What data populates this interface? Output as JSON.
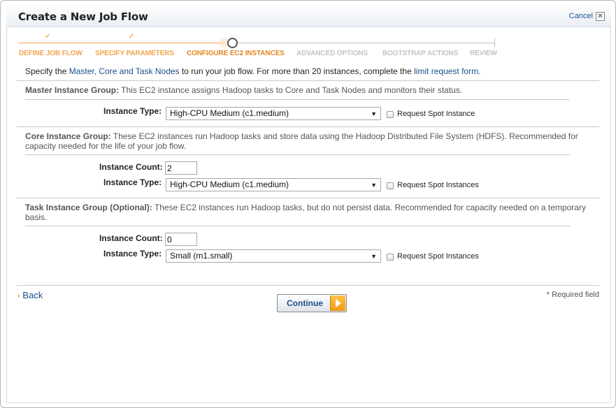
{
  "dialog": {
    "title": "Create a New Job Flow",
    "cancel_label": "Cancel",
    "close_glyph": "✕"
  },
  "wizard": {
    "steps": [
      {
        "label": "DEFINE JOB FLOW",
        "state": "done"
      },
      {
        "label": "SPECIFY PARAMETERS",
        "state": "done"
      },
      {
        "label": "CONFIGURE EC2 INSTANCES",
        "state": "current"
      },
      {
        "label": "ADVANCED OPTIONS",
        "state": "todo"
      },
      {
        "label": "BOOTSTRAP ACTIONS",
        "state": "todo"
      },
      {
        "label": "REVIEW",
        "state": "todo"
      }
    ],
    "check_glyph": "✓"
  },
  "intro": {
    "prefix": "Specify the ",
    "link1": "Master, Core and Task Nodes",
    "middle": " to run your job flow. For more than 20 instances, complete the ",
    "link2": "limit request form",
    "suffix": "."
  },
  "master": {
    "title": "Master Instance Group:",
    "desc": " This EC2 instance assigns Hadoop tasks to Core and Task Nodes and monitors their status.",
    "type_label": "Instance Type:",
    "type_value": "High-CPU Medium (c1.medium)",
    "spot_label": "Request Spot Instance",
    "spot_checked": false
  },
  "core": {
    "title": "Core Instance Group:",
    "desc": " These EC2 instances run Hadoop tasks and store data using the Hadoop Distributed File System (HDFS). Recommended for capacity needed for the life of your job flow.",
    "count_label": "Instance Count:",
    "count_value": "2",
    "type_label": "Instance Type:",
    "type_value": "High-CPU Medium (c1.medium)",
    "spot_label": "Request Spot Instances",
    "spot_checked": false
  },
  "task": {
    "title": "Task Instance Group (Optional):",
    "desc": " These EC2 instances run Hadoop tasks, but do not persist data. Recommended for capacity needed on a temporary basis.",
    "count_label": "Instance Count:",
    "count_value": "0",
    "type_label": "Instance Type:",
    "type_value": "Small (m1.small)",
    "spot_label": "Request Spot Instances",
    "spot_checked": false
  },
  "footer": {
    "back_chevron": "‹",
    "back_label": "Back",
    "required_note": "* Required field",
    "continue_label": "Continue"
  },
  "select_arrow": "▼",
  "colors": {
    "link": "#1a4f8b",
    "step_done": "#f0a64a",
    "step_current": "#e2861c",
    "step_todo": "#c2c2c2",
    "continue_play": "#f09a12"
  }
}
